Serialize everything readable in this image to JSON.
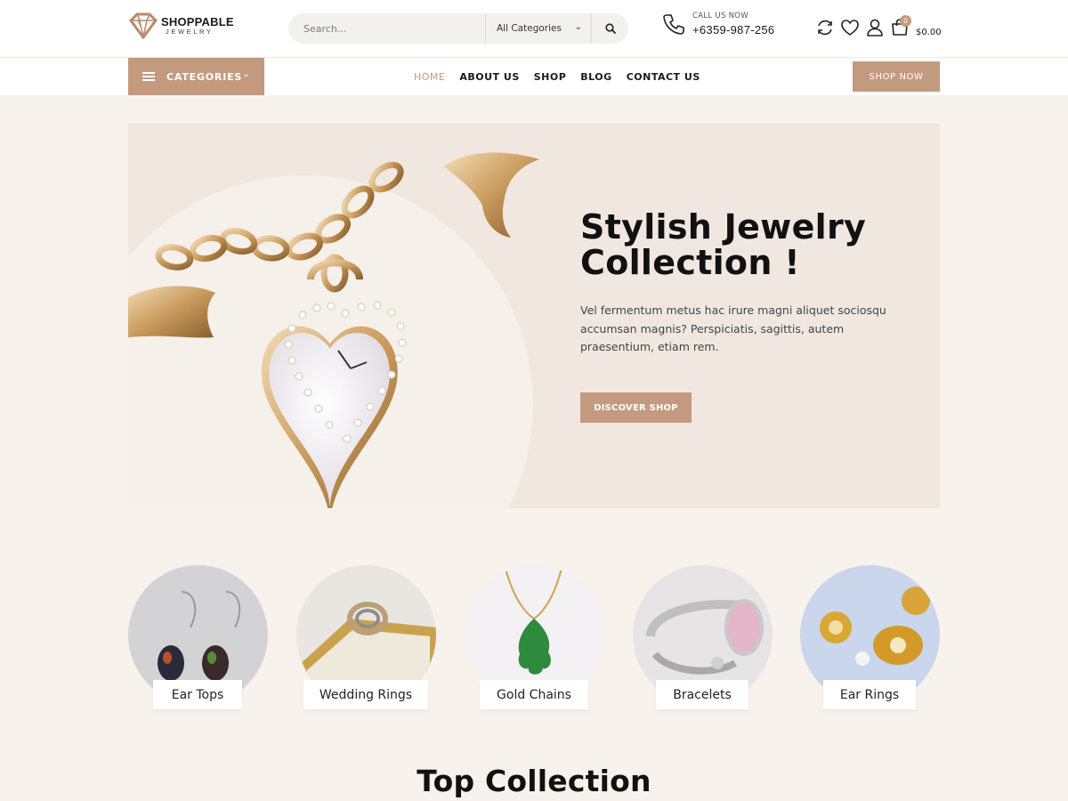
{
  "brand": {
    "name": "SHOPPABLE",
    "tagline": "JEWELRY",
    "accent": "#c49a7f"
  },
  "search": {
    "placeholder": "Search...",
    "category": "All Categories"
  },
  "contact": {
    "label": "CALL US NOW",
    "phone": "+6359-987-256"
  },
  "cart": {
    "count": "0",
    "total": "$0.00"
  },
  "icons": [
    "refresh-icon",
    "heart-icon",
    "user-icon",
    "cart-icon",
    "phone-icon",
    "search-icon",
    "menu-icon",
    "chevron-down-icon"
  ],
  "nav": {
    "categories_label": "CATEGORIES",
    "links": [
      "HOME",
      "ABOUT US",
      "SHOP",
      "BLOG",
      "CONTACT US"
    ],
    "active": "HOME",
    "shop_now": "SHOP NOW"
  },
  "hero": {
    "title_line1": "Stylish Jewelry",
    "title_line2": "Collection !",
    "text": "Vel fermentum metus hac irure magni aliquet sociosqu accumsan magnis? Perspiciatis, sagittis, autem praesentium, etiam rem.",
    "button": "DISCOVER SHOP"
  },
  "categories": [
    {
      "label": "Ear Tops"
    },
    {
      "label": "Wedding Rings"
    },
    {
      "label": "Gold Chains"
    },
    {
      "label": "Bracelets"
    },
    {
      "label": "Ear Rings"
    }
  ],
  "section": {
    "title": "Top Collection"
  }
}
